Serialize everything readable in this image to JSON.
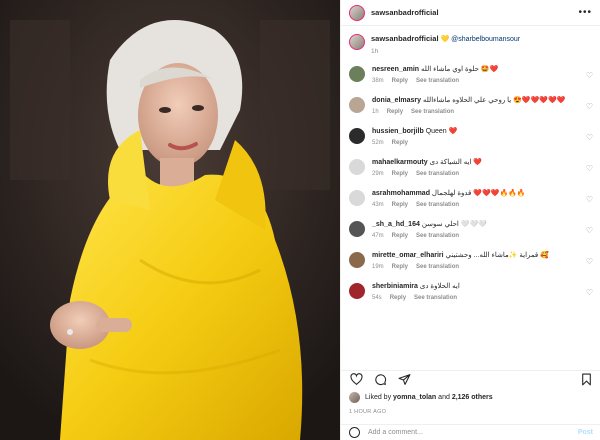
{
  "post": {
    "username": "sawsanbadrofficial",
    "more_icon": "more-icon",
    "caption_mention": "@sharbelboumansour",
    "caption_age": "1h",
    "caption_heart": "💛"
  },
  "comments": [
    {
      "user": "nesreen_amin",
      "text": "حلوة اوي ماشاء الله 🤩❤️",
      "time": "38m",
      "reply": "Reply",
      "translate": "See translation",
      "avatar": "#6a7f5a"
    },
    {
      "user": "donia_elmasry",
      "text": "يا روحي علي الحلاوه ماشاءالله 😍❤️❤️❤️❤️❤️",
      "time": "1h",
      "reply": "Reply",
      "translate": "See translation",
      "avatar": "#b8a594"
    },
    {
      "user": "hussien_borjilb",
      "text": "Queen ❤️",
      "time": "52m",
      "reply": "Reply",
      "translate": "",
      "avatar": "#2b2b2b"
    },
    {
      "user": "mahaelkarmouty",
      "text": "ايه الشياكة دى ❤️",
      "time": "29m",
      "reply": "Reply",
      "translate": "See translation",
      "avatar": "#d9d9d9"
    },
    {
      "user": "asrahmohammad",
      "text": "قدوة لهلجمال ❤️❤️❤️🔥🔥🔥",
      "time": "43m",
      "reply": "Reply",
      "translate": "See translation",
      "avatar": "#d9d9d9"
    },
    {
      "user": "_sh_a_hd_164",
      "text": "احلي سوسن 🤍🤍🤍",
      "time": "47m",
      "reply": "Reply",
      "translate": "See translation",
      "avatar": "#555555"
    },
    {
      "user": "mirette_omar_elhariri",
      "text": "قمراية ✨ماشاء الله... وحشتيني 🥰",
      "time": "19m",
      "reply": "Reply",
      "translate": "See translation",
      "avatar": "#8a6a4a"
    },
    {
      "user": "sherbiniamira",
      "text": "ايه الحلاوة دى",
      "time": "54s",
      "reply": "Reply",
      "translate": "See translation",
      "avatar": "#a0262b"
    }
  ],
  "actions": {
    "like_icon": "heart-icon",
    "comment_icon": "comment-icon",
    "share_icon": "share-icon",
    "save_icon": "bookmark-icon"
  },
  "likes": {
    "prefix": "Liked by",
    "liker": "yomna_tolan",
    "connector": "and",
    "others": "2,126 others"
  },
  "timestamp": "1 HOUR AGO",
  "add_comment": {
    "placeholder": "Add a comment...",
    "post_label": "Post"
  },
  "colors": {
    "dress": "#f7d31c",
    "background": "#2a2422",
    "link": "#00376b",
    "heart": "#ed1c24"
  }
}
